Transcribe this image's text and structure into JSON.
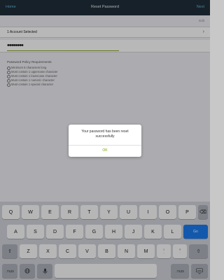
{
  "nav": {
    "left_label": "Home",
    "title": "Reset Password",
    "right_label": "Next"
  },
  "top_right_text": "Edit",
  "account": {
    "label": "1 Account Selected",
    "chevron_icon": "chevron-right-icon"
  },
  "password": {
    "masked_value": "••••••••"
  },
  "requirements": {
    "title": "Password Policy Requirements",
    "items": [
      "Minimum 8 characters long",
      "Must contain 1 uppercase character",
      "Must contain 1 lowercase character",
      "Must contain 1 numeric character",
      "Must contain 1 special character"
    ]
  },
  "modal": {
    "message": "Your password has been reset successfully",
    "ok_label": "OK"
  },
  "keyboard": {
    "row1": [
      "Q",
      "W",
      "E",
      "R",
      "T",
      "Y",
      "U",
      "I",
      "O",
      "P"
    ],
    "row2": [
      "A",
      "S",
      "D",
      "F",
      "G",
      "H",
      "J",
      "K",
      "L"
    ],
    "row3": [
      "Z",
      "X",
      "C",
      "V",
      "B",
      "N",
      "M"
    ],
    "go_label": "Go",
    "num_label": ".?123",
    "excl_top": "!",
    "excl_bottom": ",",
    "q_top": "?",
    "q_bottom": ".",
    "icons": {
      "delete": "delete-icon",
      "shift": "shift-icon",
      "globe": "globe-icon",
      "mic": "microphone-icon",
      "hide": "keyboard-hide-icon"
    }
  },
  "colors": {
    "nav_bg": "#1f2e3a",
    "accent_blue": "#1a7cf0",
    "ok_green": "#7aa300"
  }
}
